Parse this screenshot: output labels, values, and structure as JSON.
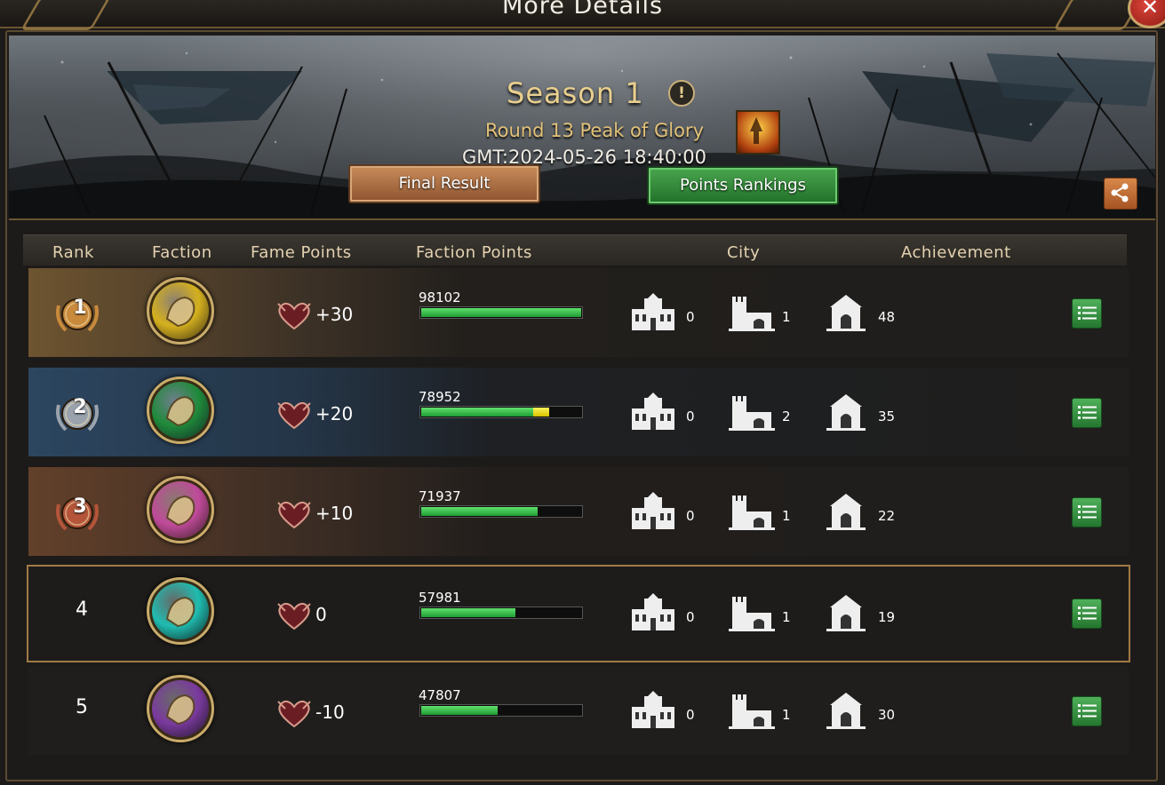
{
  "window": {
    "title": "More Details",
    "close_label": "✕"
  },
  "header": {
    "season": "Season 1",
    "info_label": "!",
    "round": "Round 13 Peak of Glory",
    "gmt": "GMT:2024-05-26 18:40:00",
    "final_result_label": "Final Result",
    "points_rankings_label": "Points Rankings"
  },
  "table": {
    "columns": {
      "rank": "Rank",
      "faction": "Faction",
      "fame_points": "Fame Points",
      "faction_points": "Faction Points",
      "city": "City",
      "achievement": "Achievement"
    },
    "rows": [
      {
        "rank": "1",
        "faction_icon": "wolf-sigil-icon",
        "faction_color": "#d4b01e",
        "fame": "+30",
        "points": "98102",
        "progress": 1.0,
        "bonus": 0.0,
        "city_a": "0",
        "city_b": "1",
        "achievement": "48",
        "medal_color": "#c98a3c"
      },
      {
        "rank": "2",
        "faction_icon": "rose-sigil-icon",
        "faction_color": "#1f8a3a",
        "fame": "+20",
        "points": "78952",
        "progress": 0.7,
        "bonus": 0.1,
        "city_a": "0",
        "city_b": "2",
        "achievement": "35",
        "medal_color": "#9aa3ad"
      },
      {
        "rank": "3",
        "faction_icon": "stag-sigil-icon",
        "faction_color": "#c04a9a",
        "fame": "+10",
        "points": "71937",
        "progress": 0.73,
        "bonus": 0.0,
        "city_a": "0",
        "city_b": "1",
        "achievement": "22",
        "medal_color": "#b4553a"
      },
      {
        "rank": "4",
        "faction_icon": "kraken-sigil-icon",
        "faction_color": "#1fbcb0",
        "fame": "0",
        "points": "57981",
        "progress": 0.59,
        "bonus": 0.0,
        "city_a": "0",
        "city_b": "1",
        "achievement": "19",
        "medal_color": ""
      },
      {
        "rank": "5",
        "faction_icon": "dragon-sigil-icon",
        "faction_color": "#7a3a9e",
        "fame": "-10",
        "points": "47807",
        "progress": 0.48,
        "bonus": 0.0,
        "city_a": "0",
        "city_b": "1",
        "achievement": "30",
        "medal_color": ""
      }
    ]
  },
  "colors": {
    "accent_gold": "#e9cf8e",
    "button_green": "#3b9a44",
    "button_orange": "#b4703f",
    "progress_green": "#3cc451",
    "progress_yellow": "#f2e02a"
  }
}
